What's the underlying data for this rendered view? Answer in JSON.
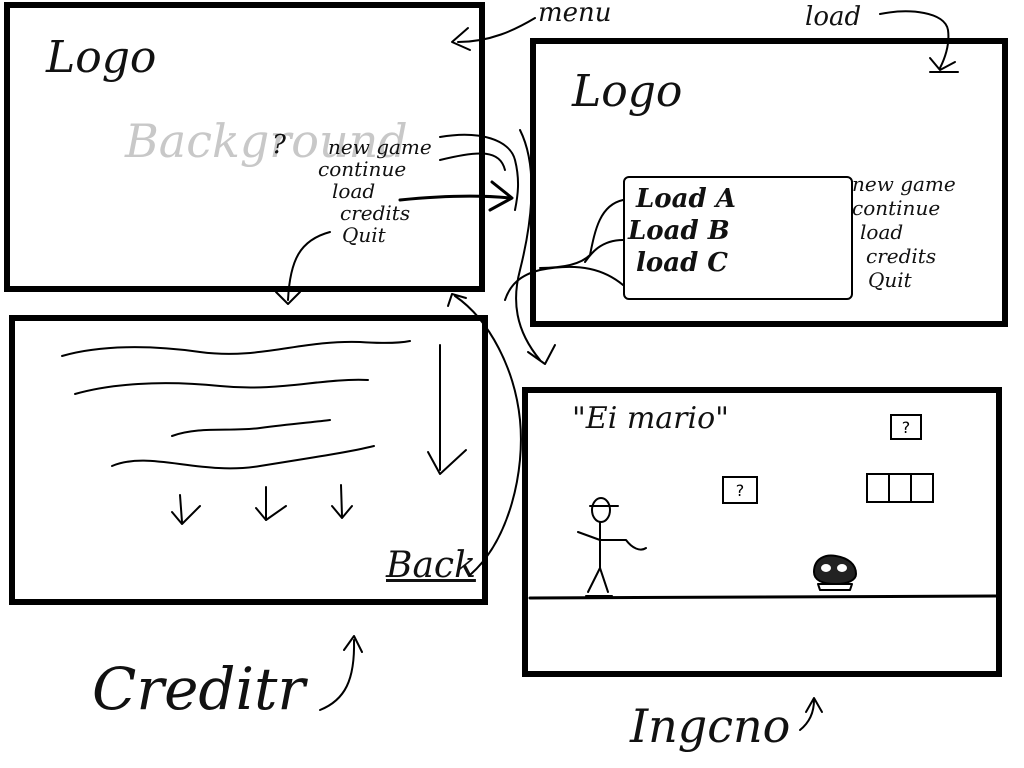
{
  "annotations": {
    "menu": "menu",
    "load": "load",
    "credits": "Creditr",
    "ingame": "Ingcno"
  },
  "menu_screen": {
    "logo": "Logo",
    "background": "Background",
    "question": "?",
    "items": [
      "new game",
      "continue",
      "load",
      "credits",
      "Quit"
    ]
  },
  "load_screen": {
    "logo": "Logo",
    "slots": [
      "Load A",
      "Load B",
      "load C"
    ],
    "items": [
      "new game",
      "continue",
      "load",
      "credits",
      "Quit"
    ]
  },
  "credits_screen": {
    "back": "Back"
  },
  "ingame_screen": {
    "title": "\"Ei mario\"",
    "question_block": "?",
    "question_block_2": "?"
  }
}
